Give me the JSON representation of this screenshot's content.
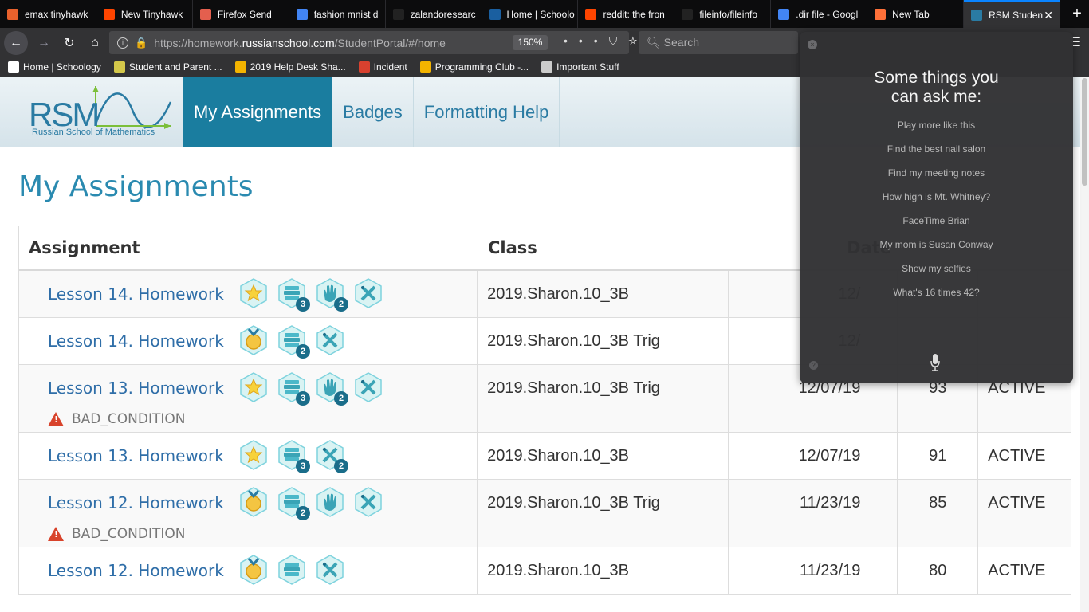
{
  "browser": {
    "tabs": [
      {
        "label": "emax tinyhawk",
        "icon": "bg-icon",
        "color": "#e8612c"
      },
      {
        "label": "New Tinyhawk",
        "icon": "reddit-icon",
        "color": "#ff4500"
      },
      {
        "label": "Firefox Send",
        "icon": "send-icon",
        "color": "#e45f4e"
      },
      {
        "label": "fashion mnist d",
        "icon": "google-icon",
        "color": "#4285f4"
      },
      {
        "label": "zalandoresearc",
        "icon": "github-icon",
        "color": "#222222"
      },
      {
        "label": "Home | Schoolo",
        "icon": "schoology-icon",
        "color": "#1a5fa0"
      },
      {
        "label": "reddit: the fron",
        "icon": "reddit-icon",
        "color": "#ff4500"
      },
      {
        "label": "fileinfo/fileinfo",
        "icon": "github-icon",
        "color": "#222222"
      },
      {
        "label": ".dir file - Googl",
        "icon": "google-icon",
        "color": "#4285f4"
      },
      {
        "label": "New Tab",
        "icon": "firefox-icon",
        "color": "#ff7139"
      },
      {
        "label": "RSM Studen",
        "icon": "rsm-icon",
        "color": "#2a7ba3"
      }
    ],
    "url_prefix": "https://homework.",
    "url_domain": "russianschool.com",
    "url_path": "/StudentPortal/#/home",
    "zoom": "150%",
    "search_placeholder": "Search",
    "bookmarks": [
      {
        "label": "Home | Schoology",
        "color": "#ffffff"
      },
      {
        "label": "Student and Parent ...",
        "color": "#d4c84a"
      },
      {
        "label": "2019 Help Desk Sha...",
        "color": "#f4b400"
      },
      {
        "label": "Incident",
        "color": "#d9412f"
      },
      {
        "label": "Programming Club -...",
        "color": "#f4b400"
      },
      {
        "label": "Important Stuff",
        "color": "#cccccc"
      }
    ]
  },
  "site": {
    "logo_text": "RSM",
    "logo_subtitle": "Russian School of Mathematics",
    "nav": [
      "My Assignments",
      "Badges",
      "Formatting Help"
    ],
    "page_title": "My Assignments",
    "columns": [
      "Assignment",
      "Class",
      "Date"
    ],
    "rows": [
      {
        "name": "Lesson 14. Homework",
        "class": "2019.Sharon.10_3B",
        "date": "12/",
        "score": "",
        "status": "",
        "badges": [
          {
            "type": "star-icon"
          },
          {
            "type": "books-icon",
            "count": "3"
          },
          {
            "type": "hand-icon",
            "count": "2"
          },
          {
            "type": "tools-icon"
          }
        ],
        "warning": ""
      },
      {
        "name": "Lesson 14. Homework",
        "class": "2019.Sharon.10_3B Trig",
        "date": "12/",
        "score": "",
        "status": "",
        "badges": [
          {
            "type": "medal-icon"
          },
          {
            "type": "books-icon",
            "count": "2"
          },
          {
            "type": "tools-icon"
          }
        ],
        "warning": ""
      },
      {
        "name": "Lesson 13. Homework",
        "class": "2019.Sharon.10_3B Trig",
        "date": "12/07/19",
        "score": "93",
        "status": "ACTIVE",
        "badges": [
          {
            "type": "star-icon"
          },
          {
            "type": "books-icon",
            "count": "3"
          },
          {
            "type": "hand-icon",
            "count": "2"
          },
          {
            "type": "tools-icon"
          }
        ],
        "warning": "BAD_CONDITION"
      },
      {
        "name": "Lesson 13. Homework",
        "class": "2019.Sharon.10_3B",
        "date": "12/07/19",
        "score": "91",
        "status": "ACTIVE",
        "badges": [
          {
            "type": "star-icon"
          },
          {
            "type": "books-icon",
            "count": "3"
          },
          {
            "type": "tools-icon",
            "count": "2"
          }
        ],
        "warning": ""
      },
      {
        "name": "Lesson 12. Homework",
        "class": "2019.Sharon.10_3B Trig",
        "date": "11/23/19",
        "score": "85",
        "status": "ACTIVE",
        "badges": [
          {
            "type": "medal-icon"
          },
          {
            "type": "books-icon",
            "count": "2"
          },
          {
            "type": "hand-icon"
          },
          {
            "type": "tools-icon"
          }
        ],
        "warning": "BAD_CONDITION"
      },
      {
        "name": "Lesson 12. Homework",
        "class": "2019.Sharon.10_3B",
        "date": "11/23/19",
        "score": "80",
        "status": "ACTIVE",
        "badges": [
          {
            "type": "medal-icon"
          },
          {
            "type": "books-icon"
          },
          {
            "type": "tools-icon"
          }
        ],
        "warning": ""
      }
    ]
  },
  "siri": {
    "title_line1": "Some things you",
    "title_line2": "can ask me:",
    "suggestions": [
      "Play more like this",
      "Find the best nail salon",
      "Find my meeting notes",
      "How high is Mt. Whitney?",
      "FaceTime Brian",
      "My mom is Susan Conway",
      "Show my selfies",
      "What's 16 times 42?"
    ]
  }
}
